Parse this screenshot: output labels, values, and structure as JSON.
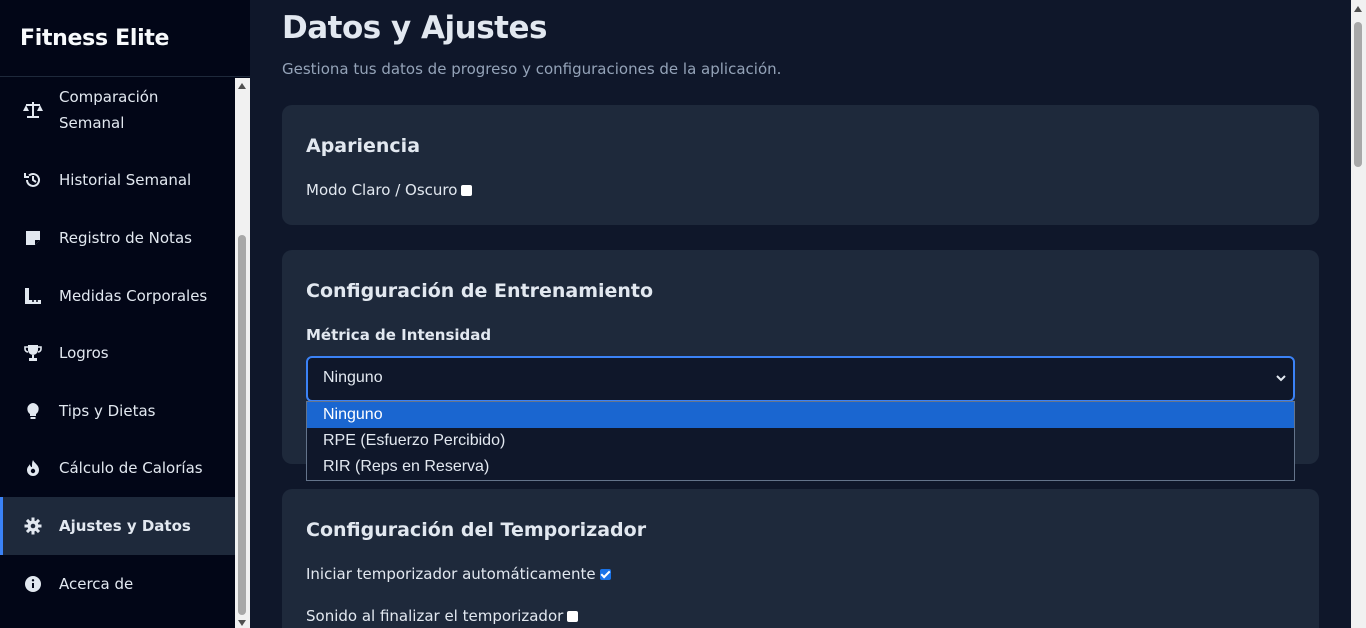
{
  "app": {
    "title": "Fitness Elite"
  },
  "sidebar": {
    "items": [
      {
        "label": "Comparación\nSemanal",
        "icon": "scale-icon"
      },
      {
        "label": "Historial Semanal",
        "icon": "history-icon"
      },
      {
        "label": "Registro de Notas",
        "icon": "note-icon"
      },
      {
        "label": "Medidas Corporales",
        "icon": "ruler-icon"
      },
      {
        "label": "Logros",
        "icon": "trophy-icon"
      },
      {
        "label": "Tips y Dietas",
        "icon": "lightbulb-icon"
      },
      {
        "label": "Cálculo de Calorías",
        "icon": "fire-icon"
      },
      {
        "label": "Ajustes y Datos",
        "icon": "gear-icon",
        "active": true
      },
      {
        "label": "Acerca de",
        "icon": "info-icon"
      }
    ]
  },
  "page": {
    "title": "Datos y Ajustes",
    "subtitle": "Gestiona tus datos de progreso y configuraciones de la aplicación."
  },
  "appearance": {
    "title": "Apariencia",
    "dark_mode_label": "Modo Claro / Oscuro",
    "dark_mode_checked": false
  },
  "training": {
    "title": "Configuración de Entrenamiento",
    "intensity_label": "Métrica de Intensidad",
    "intensity_value": "Ninguno",
    "options": [
      "Ninguno",
      "RPE (Esfuerzo Percibido)",
      "RIR (Reps en Reserva)"
    ]
  },
  "timer": {
    "title": "Configuración del Temporizador",
    "auto_start_label": "Iniciar temporizador automáticamente",
    "auto_start_checked": true,
    "sound_label": "Sonido al finalizar el temporizador",
    "sound_checked": false
  },
  "colors": {
    "accent": "#3b82f6",
    "sidebar_bg": "#020617",
    "card_bg": "#1e293b",
    "page_bg": "#0f172a"
  }
}
